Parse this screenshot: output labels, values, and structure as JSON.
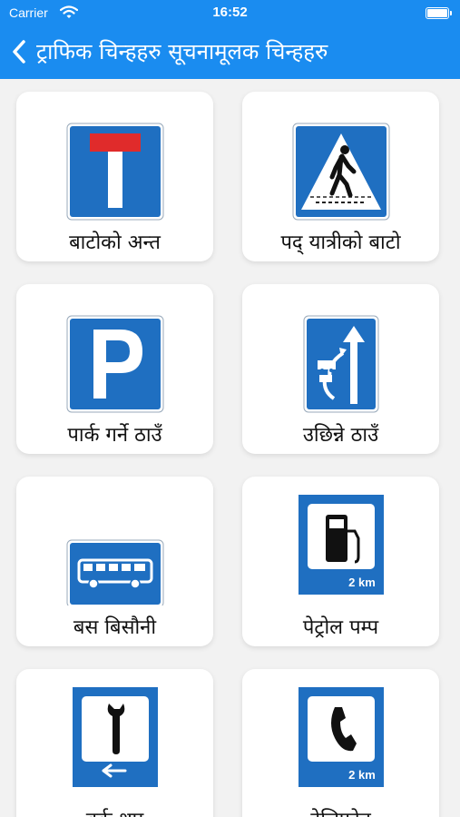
{
  "status_bar": {
    "carrier": "Carrier",
    "time": "16:52"
  },
  "nav": {
    "title": "ट्राफिक चिन्हहरु सूचनामूलक चिन्हहरु",
    "back_icon": "chevron-left-icon"
  },
  "signs": [
    {
      "label": "बाटोको अन्त",
      "icon": "dead-end-sign-icon"
    },
    {
      "label": "पद् यात्रीको बाटो",
      "icon": "pedestrian-crossing-sign-icon"
    },
    {
      "label": "पार्क गर्ने ठाउँ",
      "icon": "parking-sign-icon"
    },
    {
      "label": "उछिन्ने ठाउँ",
      "icon": "overtaking-lane-sign-icon"
    },
    {
      "label": "बस बिसौनी",
      "icon": "bus-stop-sign-icon"
    },
    {
      "label": "पेट्रोल पम्प",
      "icon": "petrol-pump-sign-icon",
      "distance": "2 km"
    },
    {
      "label": "वर्क शप",
      "icon": "workshop-sign-icon"
    },
    {
      "label": "टेलिफोन",
      "icon": "telephone-sign-icon",
      "distance": "2 km"
    }
  ],
  "colors": {
    "primary": "#1a8cf0",
    "sign_blue": "#1f6fc1",
    "sign_red": "#e02b2b"
  }
}
